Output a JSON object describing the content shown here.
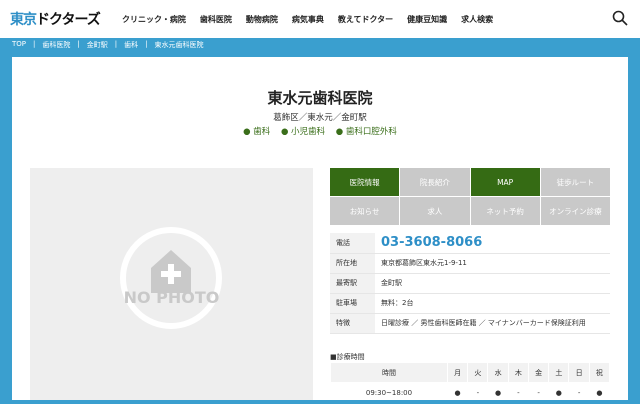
{
  "header": {
    "logo_a": "東京",
    "logo_b": "ドクターズ",
    "nav": [
      "クリニック・病院",
      "歯科医院",
      "動物病院",
      "病気事典",
      "教えてドクター",
      "健康豆知識",
      "求人検索"
    ]
  },
  "breadcrumb": [
    "TOP",
    "|",
    "歯科医院",
    "|",
    "金町駅",
    "|",
    "歯科",
    "|",
    "東水元歯科医院"
  ],
  "clinic": {
    "name": "東水元歯科医院",
    "location": "葛飾区／東水元／金町駅",
    "categories": [
      "● 歯科",
      "● 小児歯科",
      "● 歯科口腔外科"
    ],
    "photo_label": "NO PHOTO"
  },
  "buttons": [
    {
      "label": "医院情報",
      "active": true
    },
    {
      "label": "院長紹介",
      "active": false
    },
    {
      "label": "MAP",
      "active": true
    },
    {
      "label": "徒歩ルート",
      "active": false
    },
    {
      "label": "お知らせ",
      "active": false
    },
    {
      "label": "求人",
      "active": false
    },
    {
      "label": "ネット予約",
      "active": false
    },
    {
      "label": "オンライン診療",
      "active": false
    }
  ],
  "info": [
    {
      "k": "電話",
      "v": "03-3608-8066"
    },
    {
      "k": "所在地",
      "v": "東京都葛飾区東水元1-9-11"
    },
    {
      "k": "最寄駅",
      "v": "金町駅"
    },
    {
      "k": "駐車場",
      "v": "無料：2台"
    },
    {
      "k": "特徴",
      "v": "日曜診療 ／ 男性歯科医師在籍 ／ マイナンバーカード保険証利用"
    }
  ],
  "hours": {
    "label": "■診療時間",
    "headers": [
      "時間",
      "月",
      "火",
      "水",
      "木",
      "金",
      "土",
      "日",
      "祝"
    ],
    "rows": [
      [
        "09:30~18:00",
        "●",
        "-",
        "●",
        "-",
        "-",
        "●",
        "-",
        "●"
      ]
    ]
  }
}
